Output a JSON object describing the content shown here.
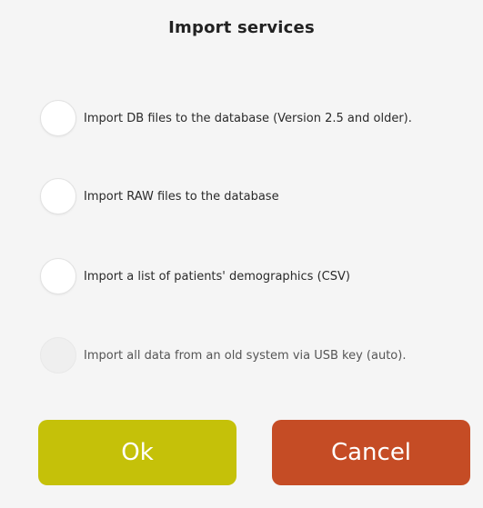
{
  "dialog": {
    "title": "Import services",
    "options": [
      {
        "label": "Import DB files to the database (Version 2.5 and older).",
        "enabled": true,
        "selected": false
      },
      {
        "label": "Import RAW files to the database",
        "enabled": true,
        "selected": false
      },
      {
        "label": "Import a list of patients' demographics (CSV)",
        "enabled": true,
        "selected": false
      },
      {
        "label": "Import all data from an old system via USB key (auto).",
        "enabled": false,
        "selected": false
      }
    ],
    "ok_label": "Ok",
    "cancel_label": "Cancel"
  },
  "colors": {
    "background": "#f5f5f5",
    "ok_button": "#c5c109",
    "cancel_button": "#c54c25",
    "button_text": "#ffffff"
  }
}
